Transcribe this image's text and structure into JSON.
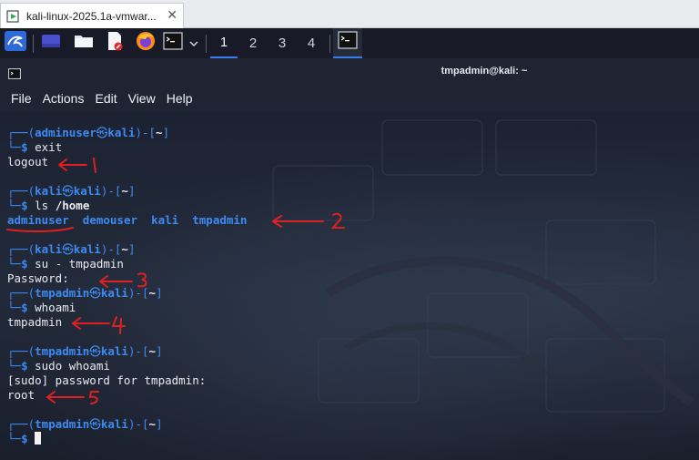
{
  "vmware": {
    "tab_title": "kali-linux-2025.1a-vmwar...",
    "close_glyph": "✕"
  },
  "panel": {
    "workspaces": [
      "1",
      "2",
      "3",
      "4"
    ],
    "active_workspace": "1"
  },
  "terminal": {
    "window_title": "tmpadmin@kali: ~",
    "menu": [
      "File",
      "Actions",
      "Edit",
      "View",
      "Help"
    ],
    "sessions": [
      {
        "user": "adminuser",
        "host": "kali",
        "dir": "~",
        "cmd": "exit",
        "output": [
          "logout"
        ]
      },
      {
        "user": "kali",
        "host": "kali",
        "dir": "~",
        "cmd_base": "ls",
        "cmd_arg": "/home",
        "dirs": [
          "adminuser",
          "demouser",
          "kali",
          "tmpadmin"
        ]
      },
      {
        "user": "kali",
        "host": "kali",
        "dir": "~",
        "cmd": "su - tmpadmin",
        "output": [
          "Password:"
        ]
      },
      {
        "user": "tmpadmin",
        "host": "kali",
        "dir": "~",
        "cmd": "whoami",
        "output": [
          "tmpadmin"
        ]
      },
      {
        "user": "tmpadmin",
        "host": "kali",
        "dir": "~",
        "cmd": "sudo whoami",
        "output": [
          "[sudo] password for tmpadmin:",
          "root"
        ]
      },
      {
        "user": "tmpadmin",
        "host": "kali",
        "dir": "~",
        "cmd": ""
      }
    ]
  },
  "annotations": [
    "1",
    "2",
    "3",
    "4",
    "5"
  ],
  "colors": {
    "prompt_blue": "#3d8bf2",
    "annotation_red": "#e02020",
    "accent": "#367bf0"
  }
}
